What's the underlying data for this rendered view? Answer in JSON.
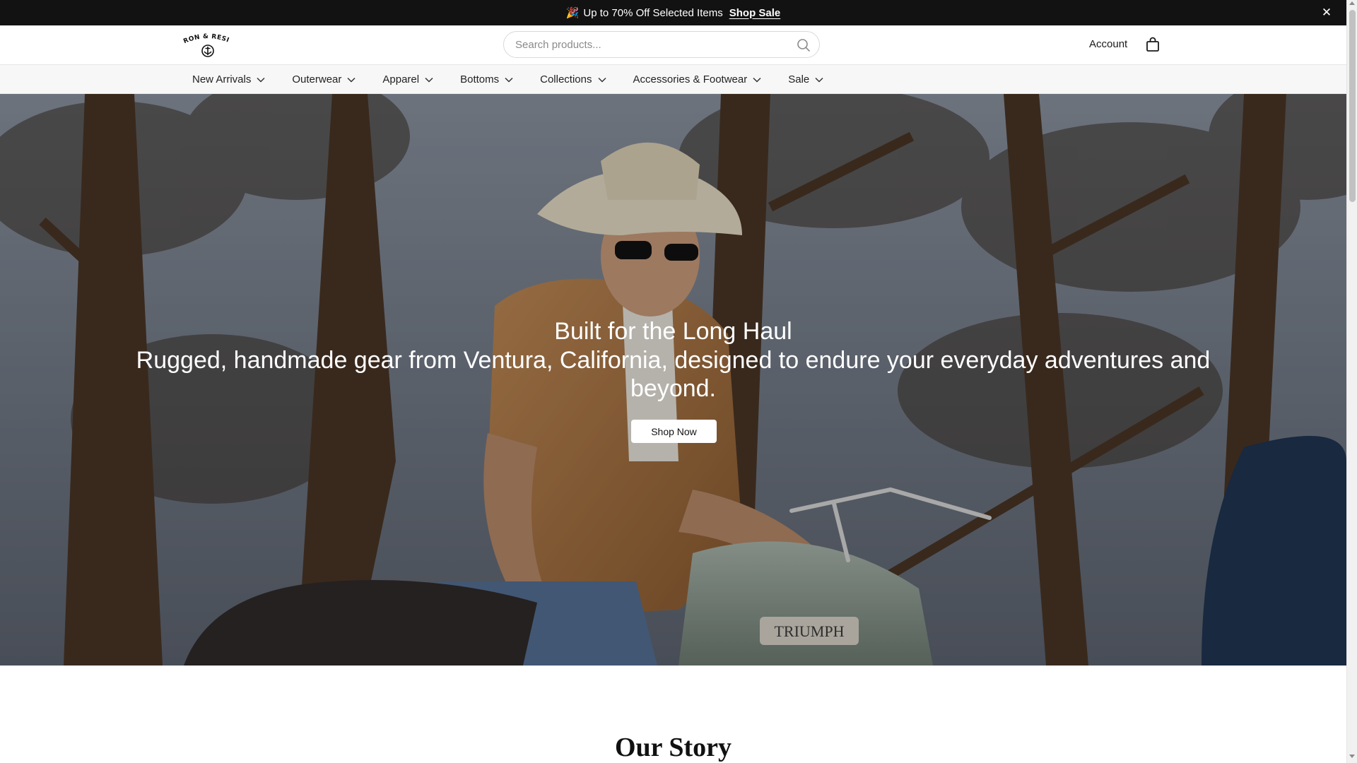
{
  "announcement": {
    "emoji": "🎉",
    "text": "Up to 70% Off Selected Items",
    "link": "Shop Sale",
    "close_icon": "close-icon"
  },
  "header": {
    "logo_text": "IRON & RESIN",
    "search_placeholder": "Search products...",
    "search_icon": "search-icon",
    "account_label": "Account",
    "cart_icon": "shopping-bag-icon"
  },
  "nav": {
    "items": [
      {
        "label": "New Arrivals"
      },
      {
        "label": "Outerwear"
      },
      {
        "label": "Apparel"
      },
      {
        "label": "Bottoms"
      },
      {
        "label": "Collections"
      },
      {
        "label": "Accessories & Footwear"
      },
      {
        "label": "Sale"
      }
    ],
    "chevron_icon": "chevron-down-icon"
  },
  "hero": {
    "title": "Built for the Long Haul",
    "subtitle": "Rugged, handmade gear from Ventura, California, designed to endure your everyday adventures and beyond.",
    "cta_label": "Shop Now",
    "tank_badge": "TRIUMPH"
  },
  "story": {
    "title": "Our Story"
  },
  "colors": {
    "announcement_bg": "#121212",
    "nav_bg": "#f7f7f7",
    "text_primary": "#1a1a1a"
  }
}
